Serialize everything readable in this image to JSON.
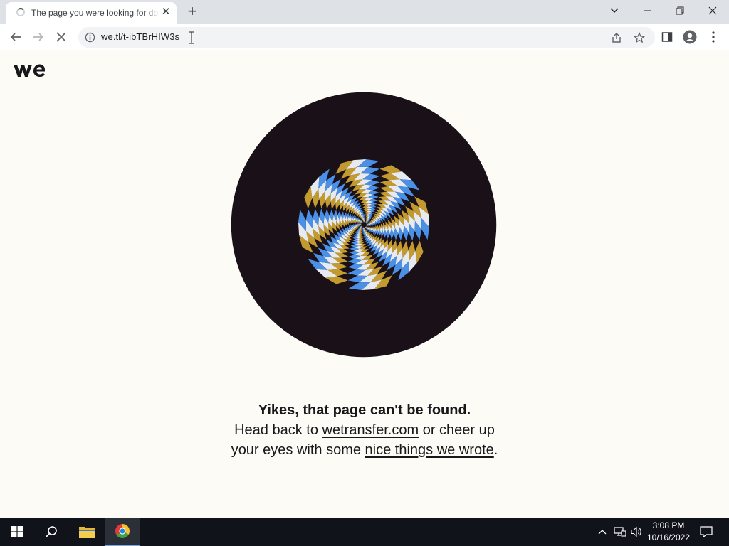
{
  "browser": {
    "tab": {
      "title": "The page you were looking for doesn't exist"
    },
    "url": "we.tl/t-ibTBrHIW3s"
  },
  "page": {
    "brand": "wetransfer",
    "title": "Yikes, that page can't be found.",
    "text_prefix": "Head back to ",
    "link1": "wetransfer.com",
    "text_middle": " or cheer up your eyes with some ",
    "link2": "nice things we wrote",
    "text_suffix": "."
  },
  "spiral_colors": [
    "#e7ebef",
    "#4a90e6",
    "#1a1118",
    "#c29a2f"
  ],
  "taskbar": {
    "time": "3:08 PM",
    "date": "10/16/2022"
  }
}
